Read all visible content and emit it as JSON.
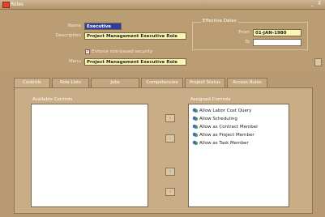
{
  "window": {
    "title": "Roles",
    "controls": [
      "_",
      "⊼"
    ]
  },
  "header": {
    "name_label": "Name",
    "name_value": "Executive",
    "description_label": "Description",
    "description_value": "Project Management Executive Role",
    "enforce_label": "Enforce role-based security",
    "enforce_checked": "✓",
    "menu_label": "Menu",
    "menu_value": "Project Management Executive Role"
  },
  "effective_dates": {
    "title": "Effective Dates",
    "from_label": "From",
    "from_value": "01-JAN-1980",
    "to_label": "To",
    "to_value": ""
  },
  "tabs": [
    {
      "label": "Controls",
      "active": true
    },
    {
      "label": "Role Lists"
    },
    {
      "label": "Jobs"
    },
    {
      "label": "Competencies"
    },
    {
      "label": "Project Status"
    },
    {
      "label": "Access Rules"
    }
  ],
  "controls_panel": {
    "available_label": "Available Controls",
    "assigned_label": "Assigned Controls",
    "available_items": [],
    "assigned_items": [
      "Allow Labor Cost Query",
      "Allow Scheduling",
      "Allow as Contract Member",
      "Allow as Project Member",
      "Allow as Task Member"
    ],
    "move_buttons": [
      {
        "label": "»",
        "state": "disabled",
        "icon": "move-all-right-icon"
      },
      {
        "label": "›",
        "state": "disabled",
        "icon": "move-right-icon"
      },
      {
        "label": "‹",
        "state": "enabled",
        "icon": "move-left-icon"
      },
      {
        "label": "«",
        "state": "disabled",
        "icon": "move-all-left-icon"
      }
    ]
  },
  "colors": {
    "accent": "#2f3d9c",
    "field_bg": "#fbf6b4",
    "form_bg": "#bb9d74"
  }
}
